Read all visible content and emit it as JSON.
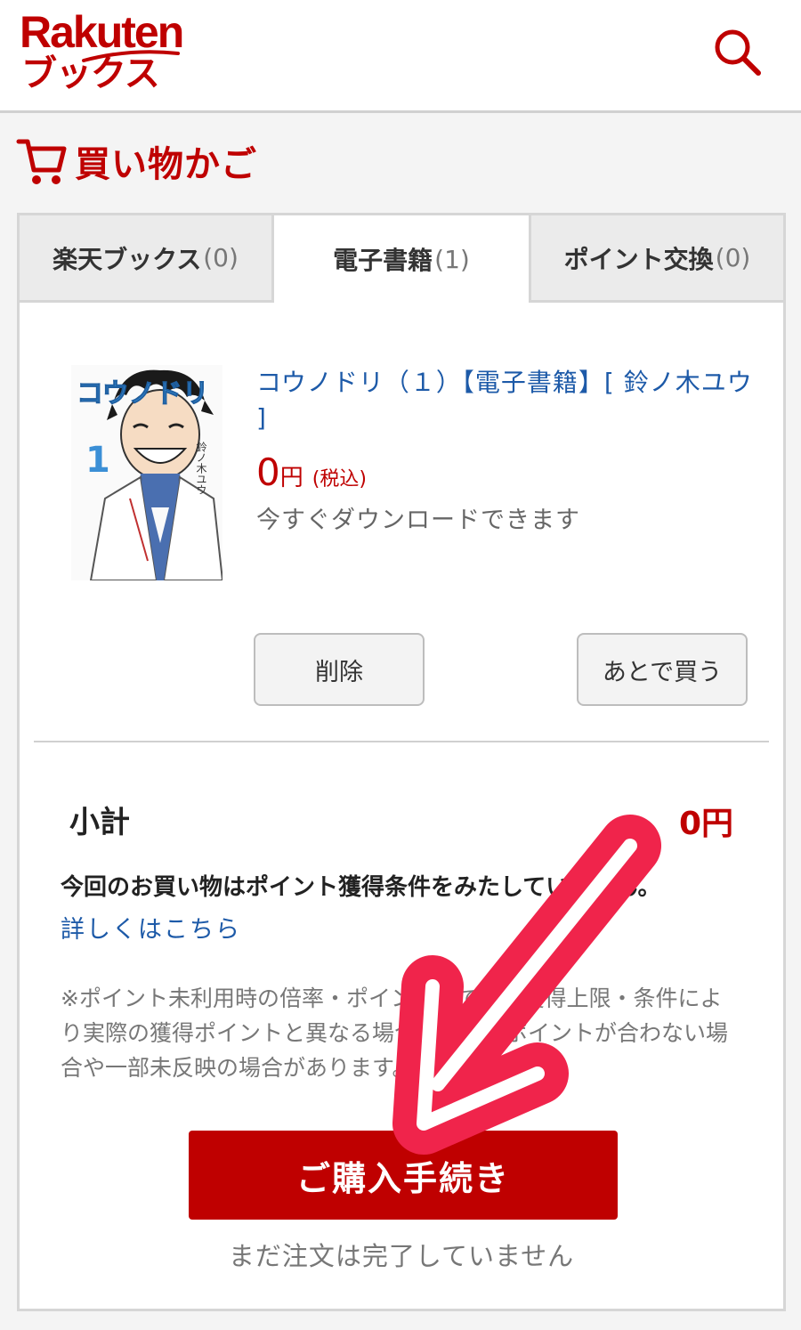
{
  "header": {
    "logo_top": "Rakuten",
    "logo_bottom": "ブックス",
    "search_icon": "search-icon"
  },
  "page": {
    "title": "買い物かご",
    "cart_icon": "cart-icon"
  },
  "tabs": [
    {
      "label": "楽天ブックス",
      "count": "(0)",
      "active": false
    },
    {
      "label": "電子書籍",
      "count": "(1)",
      "active": true
    },
    {
      "label": "ポイント交換",
      "count": "(0)",
      "active": false
    }
  ],
  "item": {
    "title": "コウノドリ（１）【電子書籍】[ 鈴ノ木ユウ ]",
    "cover_title": "コウノドリ",
    "cover_volume": "1",
    "cover_author": "鈴ノ木ユウ",
    "price": "0",
    "price_unit": "円",
    "price_tax": "(税込)",
    "download_note": "今すぐダウンロードできます",
    "delete_label": "削除",
    "later_label": "あとで買う"
  },
  "summary": {
    "subtotal_label": "小計",
    "subtotal_value": "0円",
    "points_note": "今回のお買い物はポイント獲得条件をみたしていません。",
    "details_link": "詳しくはこちら",
    "disclaimer": "※ポイント未利用時の倍率・ポイント数です。獲得上限・条件により実際の獲得ポイントと異なる場合、倍率とポイントが合わない場合や一部未反映の場合があります。"
  },
  "checkout": {
    "button_label": "ご購入手続き",
    "note": "まだ注文は完了していません"
  },
  "colors": {
    "brand_red": "#bf0000",
    "link_blue": "#1d5aa8",
    "arrow_pink": "#f0244b"
  }
}
